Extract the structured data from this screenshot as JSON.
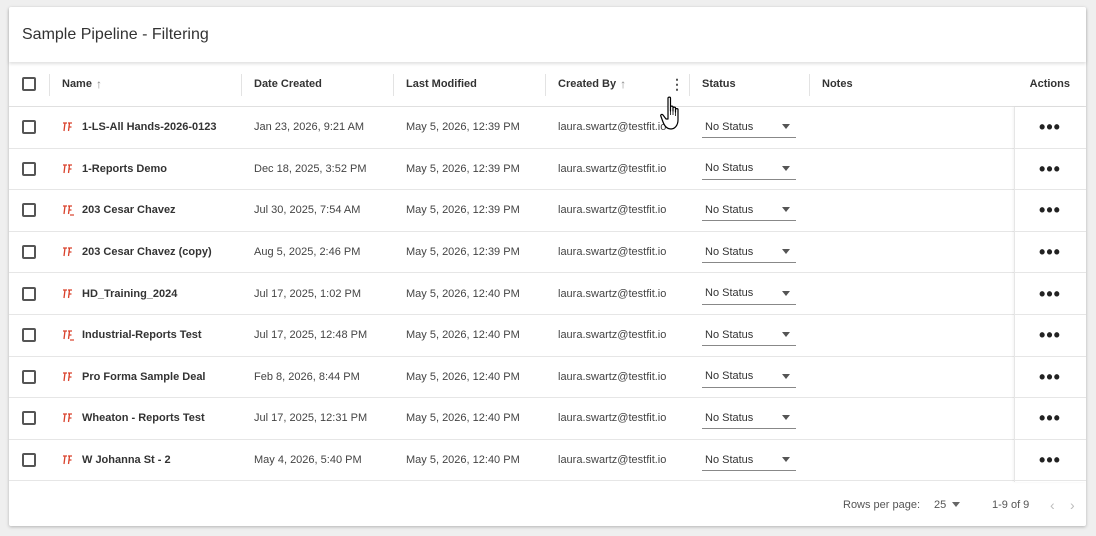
{
  "title": "Sample Pipeline - Filtering",
  "columns": {
    "name": "Name",
    "date_created": "Date Created",
    "last_modified": "Last Modified",
    "created_by": "Created By",
    "status": "Status",
    "notes": "Notes",
    "actions": "Actions"
  },
  "sort_icon": "arrow-up",
  "rows": [
    {
      "name": "1-LS-All Hands-2026-0123",
      "created": "Jan 23, 2026, 9:21 AM",
      "modified": "May 5, 2026, 12:39 PM",
      "by": "laura.swartz@testfit.io",
      "status": "No Status",
      "icon": "tf"
    },
    {
      "name": "1-Reports Demo",
      "created": "Dec 18, 2025, 3:52 PM",
      "modified": "May 5, 2026, 12:39 PM",
      "by": "laura.swartz@testfit.io",
      "status": "No Status",
      "icon": "tf"
    },
    {
      "name": "203 Cesar Chavez",
      "created": "Jul 30, 2025, 7:54 AM",
      "modified": "May 5, 2026, 12:39 PM",
      "by": "laura.swartz@testfit.io",
      "status": "No Status",
      "icon": "tf-industrial"
    },
    {
      "name": "203 Cesar Chavez (copy)",
      "created": "Aug 5, 2025, 2:46 PM",
      "modified": "May 5, 2026, 12:39 PM",
      "by": "laura.swartz@testfit.io",
      "status": "No Status",
      "icon": "tf"
    },
    {
      "name": "HD_Training_2024",
      "created": "Jul 17, 2025, 1:02 PM",
      "modified": "May 5, 2026, 12:40 PM",
      "by": "laura.swartz@testfit.io",
      "status": "No Status",
      "icon": "tf"
    },
    {
      "name": "Industrial-Reports Test",
      "created": "Jul 17, 2025, 12:48 PM",
      "modified": "May 5, 2026, 12:40 PM",
      "by": "laura.swartz@testfit.io",
      "status": "No Status",
      "icon": "tf-industrial"
    },
    {
      "name": "Pro Forma Sample Deal",
      "created": "Feb 8, 2026, 8:44 PM",
      "modified": "May 5, 2026, 12:40 PM",
      "by": "laura.swartz@testfit.io",
      "status": "No Status",
      "icon": "tf"
    },
    {
      "name": "Wheaton - Reports Test",
      "created": "Jul 17, 2025, 12:31 PM",
      "modified": "May 5, 2026, 12:40 PM",
      "by": "laura.swartz@testfit.io",
      "status": "No Status",
      "icon": "tf"
    },
    {
      "name": "W Johanna St - 2",
      "created": "May 4, 2026, 5:40 PM",
      "modified": "May 5, 2026, 12:40 PM",
      "by": "laura.swartz@testfit.io",
      "status": "No Status",
      "icon": "tf"
    }
  ],
  "footer": {
    "rows_per_page_label": "Rows per page:",
    "rows_per_page_value": "25",
    "range": "1-9 of 9"
  },
  "colors": {
    "icon_accent": "#d9412b",
    "background": "#efefef"
  }
}
